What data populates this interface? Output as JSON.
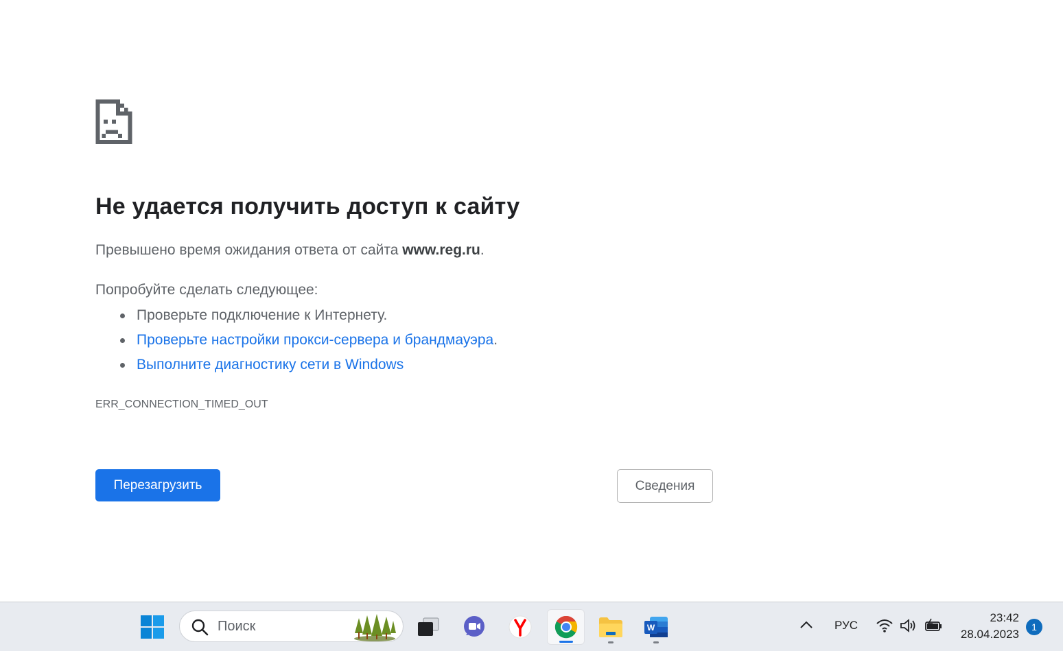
{
  "error_page": {
    "title": "Не удается получить доступ к сайту",
    "description_prefix": "Превышено время ожидания ответа от сайта ",
    "site": "www.reg.ru",
    "description_suffix": ".",
    "try_label": "Попробуйте сделать следующее:",
    "suggestions": [
      {
        "text": "Проверьте подключение к Интернету.",
        "link": false
      },
      {
        "text": "Проверьте настройки прокси-сервера и брандмауэра",
        "link": true,
        "trailing": "."
      },
      {
        "text": "Выполните диагностику сети в Windows",
        "link": true,
        "trailing": ""
      }
    ],
    "error_code": "ERR_CONNECTION_TIMED_OUT",
    "reload_label": "Перезагрузить",
    "details_label": "Сведения",
    "icon": "sad-document-icon"
  },
  "taskbar": {
    "search_placeholder": "Поиск",
    "apps": [
      {
        "name": "start-button",
        "icon": "windows-logo-icon"
      },
      {
        "name": "task-view",
        "icon": "task-view-icon"
      },
      {
        "name": "teams-chat",
        "icon": "video-chat-icon"
      },
      {
        "name": "yandex-browser",
        "icon": "yandex-icon"
      },
      {
        "name": "chrome",
        "icon": "chrome-icon",
        "active": true
      },
      {
        "name": "file-explorer",
        "icon": "folder-icon"
      },
      {
        "name": "word",
        "icon": "word-icon"
      }
    ],
    "tray": {
      "language": "РУС",
      "time": "23:42",
      "date": "28.04.2023",
      "notifications": "1"
    }
  },
  "colors": {
    "accent": "#1a73e8",
    "text": "#202124",
    "muted": "#5f6368",
    "taskbar": "#e8ebf0"
  }
}
